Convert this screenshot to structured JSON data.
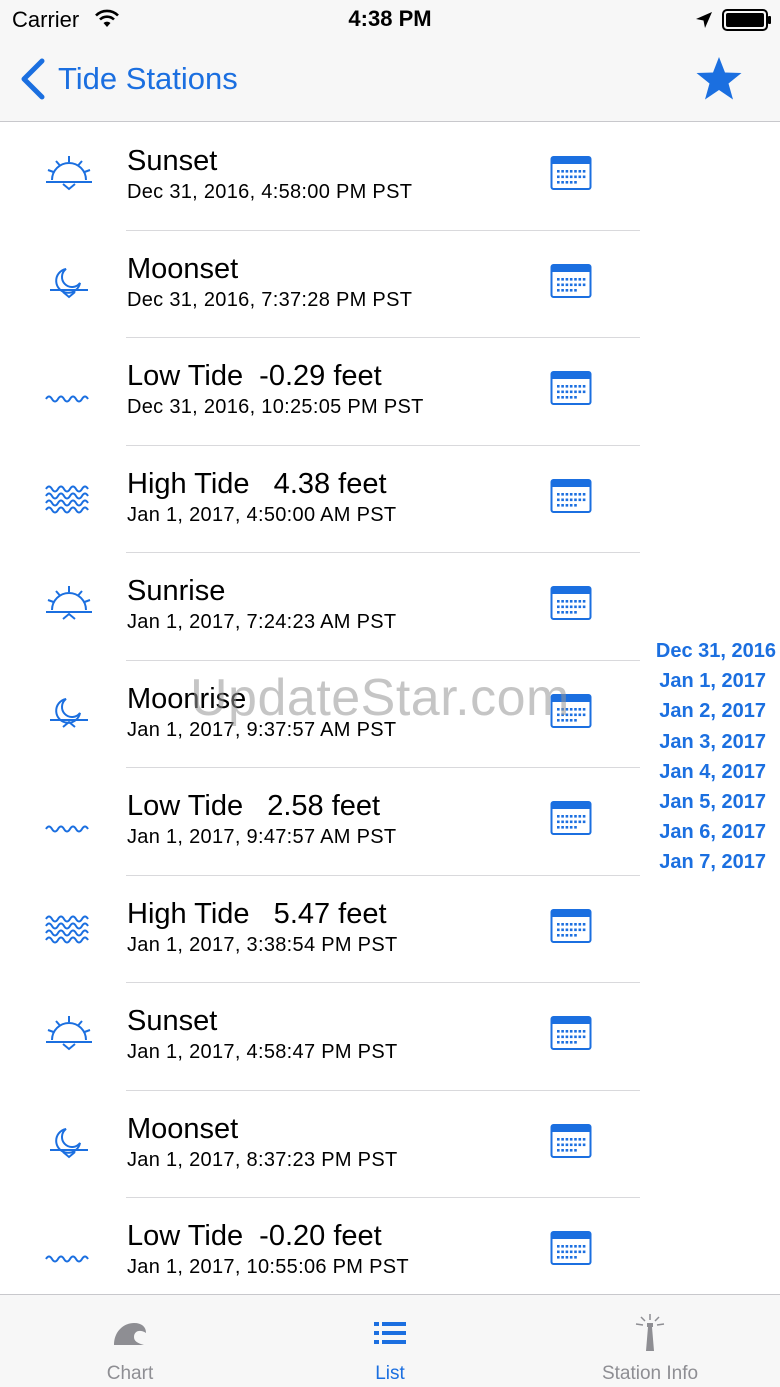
{
  "status_bar": {
    "carrier": "Carrier",
    "time": "4:38 PM"
  },
  "nav": {
    "back_label": "Tide Stations",
    "favorite_icon": "star-icon"
  },
  "accent_color": "#1b6fe0",
  "events": [
    {
      "title": "Sunset",
      "date": "Dec 31, 2016, 4:58:00 PM PST",
      "icon": "sunset-icon"
    },
    {
      "title": "Moonset",
      "date": "Dec 31, 2016, 7:37:28 PM PST",
      "icon": "moonset-icon"
    },
    {
      "title": "Low Tide  -0.29 feet",
      "date": "Dec 31, 2016, 10:25:05 PM PST",
      "icon": "low-tide-icon"
    },
    {
      "title": "High Tide   4.38 feet",
      "date": "Jan 1, 2017, 4:50:00 AM PST",
      "icon": "high-tide-icon"
    },
    {
      "title": "Sunrise",
      "date": "Jan 1, 2017, 7:24:23 AM PST",
      "icon": "sunrise-icon"
    },
    {
      "title": "Moonrise",
      "date": "Jan 1, 2017, 9:37:57 AM PST",
      "icon": "moonrise-icon"
    },
    {
      "title": "Low Tide   2.58 feet",
      "date": "Jan 1, 2017, 9:47:57 AM PST",
      "icon": "low-tide-icon"
    },
    {
      "title": "High Tide   5.47 feet",
      "date": "Jan 1, 2017, 3:38:54 PM PST",
      "icon": "high-tide-icon"
    },
    {
      "title": "Sunset",
      "date": "Jan 1, 2017, 4:58:47 PM PST",
      "icon": "sunset-icon"
    },
    {
      "title": "Moonset",
      "date": "Jan 1, 2017, 8:37:23 PM PST",
      "icon": "moonset-icon"
    },
    {
      "title": "Low Tide  -0.20 feet",
      "date": "Jan 1, 2017, 10:55:06 PM PST",
      "icon": "low-tide-icon"
    }
  ],
  "date_index": [
    "Dec 31, 2016",
    "Jan 1, 2017",
    "Jan 2, 2017",
    "Jan 3, 2017",
    "Jan 4, 2017",
    "Jan 5, 2017",
    "Jan 6, 2017",
    "Jan 7, 2017"
  ],
  "watermark": "UpdateStar.com",
  "tabs": [
    {
      "label": "Chart",
      "icon": "wave-icon",
      "active": false
    },
    {
      "label": "List",
      "icon": "list-icon",
      "active": true
    },
    {
      "label": "Station Info",
      "icon": "lighthouse-icon",
      "active": false
    }
  ]
}
